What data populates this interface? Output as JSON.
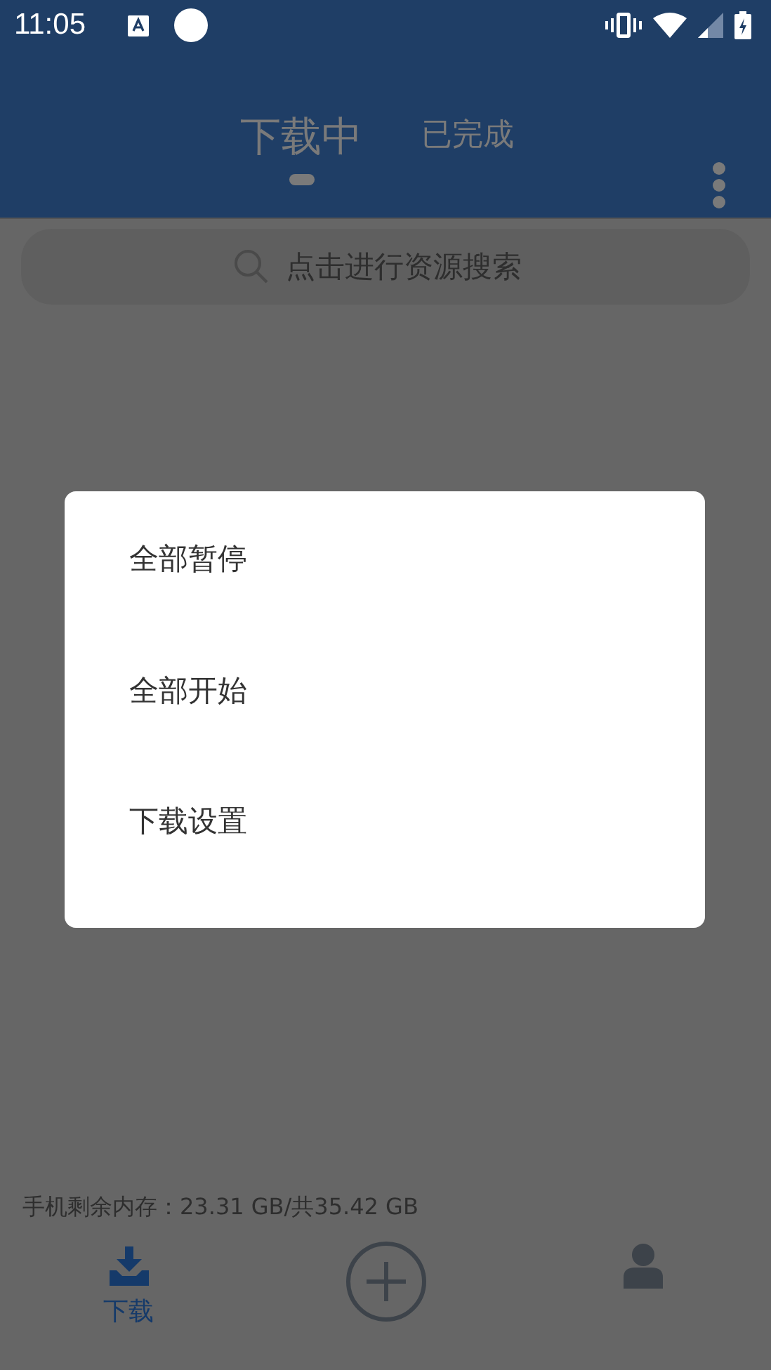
{
  "status_bar": {
    "time": "11:05"
  },
  "tabs": [
    {
      "label": "下载中",
      "selected": true
    },
    {
      "label": "已完成",
      "selected": false
    }
  ],
  "search": {
    "placeholder": "点击进行资源搜索"
  },
  "menu": {
    "items": [
      "全部暂停",
      "全部开始",
      "下载设置"
    ]
  },
  "storage": "手机剩余内存：23.31 GB/共35.42 GB",
  "bottom_nav": [
    {
      "kind": "download",
      "label": "下载",
      "selected": true
    },
    {
      "kind": "add",
      "selected": false
    },
    {
      "kind": "profile",
      "selected": false
    }
  ]
}
